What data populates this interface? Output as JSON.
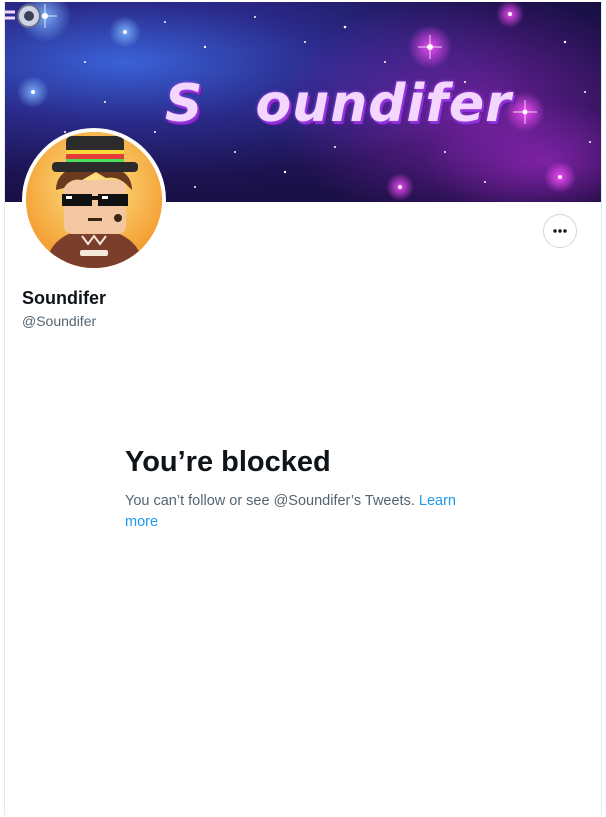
{
  "profile": {
    "banner_text": "Soundifer",
    "display_name": "Soundifer",
    "handle": "@Soundifer",
    "avatar_icon": "cartoon-avatar",
    "more_icon": "more-horizontal-icon"
  },
  "blocked": {
    "title": "You’re blocked",
    "description": "You can’t follow or see @Soundifer’s Tweets.",
    "learn_more": "Learn more"
  },
  "colors": {
    "accent": "#1d9bf0",
    "primary_text": "#0f1419",
    "secondary_text": "#536471",
    "banner_bg": "#1c124e",
    "logo_text": "#f3d7ff"
  }
}
